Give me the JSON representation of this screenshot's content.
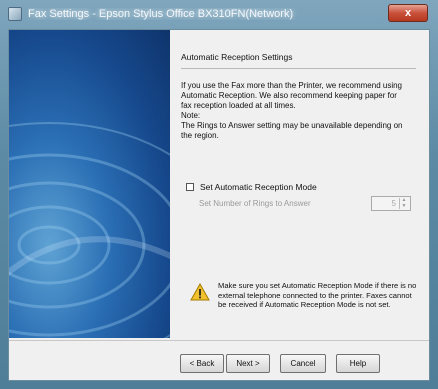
{
  "window": {
    "title": "Fax Settings - Epson Stylus Office BX310FN(Network)",
    "close_glyph": "x",
    "icon": "printer-icon"
  },
  "section": {
    "heading": "Automatic Reception Settings",
    "description": "If you use the Fax more than the Printer, we recommend using\nAutomatic Reception. We also recommend keeping paper for\nfax reception loaded at all times.\nNote:\nThe Rings to Answer setting may be unavailable depending on\nthe region."
  },
  "options": {
    "auto_reception_label": "Set Automatic Reception Mode",
    "auto_reception_checked": false,
    "rings_label": "Set Number of Rings to Answer",
    "rings_value": "5",
    "rings_enabled": false
  },
  "warning": {
    "icon": "warning-icon",
    "text": "Make sure you set Automatic Reception Mode if there is no external telephone connected to the printer. Faxes cannot be received if Automatic Reception Mode is not set."
  },
  "buttons": {
    "back": "< Back",
    "next": "Next >",
    "cancel": "Cancel",
    "help": "Help"
  },
  "colors": {
    "art_dark": "#0f346b",
    "art_light": "#5fa3d4",
    "warning_yellow": "#f2c12e"
  }
}
